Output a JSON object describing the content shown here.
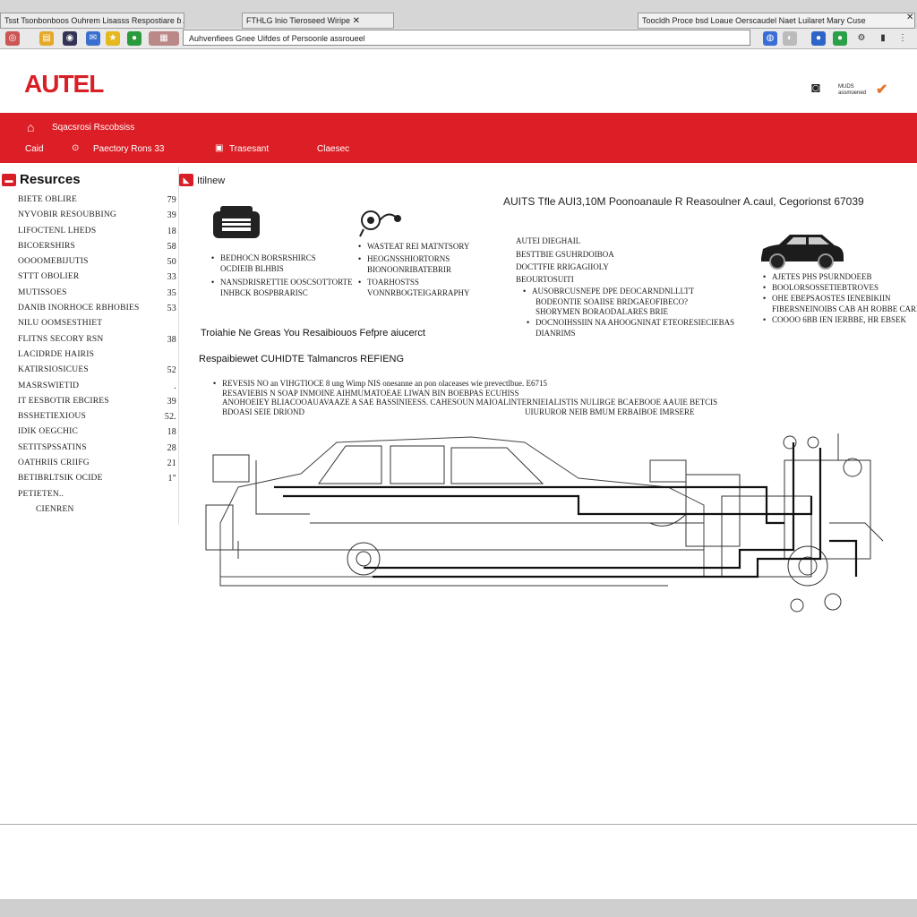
{
  "browser": {
    "tab1": "Tsst Tsonbonboos Ouhrem Lisasss  Respostiare ɓ  Aaudsaries",
    "tab2": "FTHLG lnio Tieroseed Wiripe",
    "tab3": "Toocldh Proce bsd Loaue  Oerscaudel Naet  Luilaret Mary Cuse",
    "address": "Auhvenfiees Gnee Uifdes of Persoonle assroueel"
  },
  "header": {
    "logo": "AUTEL",
    "right_caption": "MUDS\nassmoened"
  },
  "nav": {
    "top_label": "Sqacsrosi Rscobsiss",
    "item1": "Caid",
    "item2": "Paectory Rons 33",
    "item3": "Trasesant",
    "item4": "Claesec"
  },
  "sidebar": {
    "title": "Resurces",
    "items": [
      {
        "label": "BIETE  OBLIRE",
        "count": "79"
      },
      {
        "label": "NYVOBIR RESOUBBING",
        "count": "39"
      },
      {
        "label": "LIFOCTENL LHEDS",
        "count": "18"
      },
      {
        "label": "BICOERSHIRS",
        "count": "58"
      },
      {
        "label": "OOOOMEBIJUTIS",
        "count": "50"
      },
      {
        "label": "STTT OBOLIER",
        "count": "33"
      },
      {
        "label": "MUTISSOES",
        "count": "35"
      },
      {
        "label": "DANIB INORHOCE RBHOBIES",
        "count": "53"
      },
      {
        "label": "NILU OOMSESTHIET",
        "count": ""
      },
      {
        "label": "FLITNS SECORY RSN",
        "count": "38"
      },
      {
        "label": "LACIDRDE HAIRIS",
        "count": ""
      },
      {
        "label": "KATIRSIOSICUES",
        "count": "52"
      },
      {
        "label": "MASRSWIETID",
        "count": "."
      },
      {
        "label": "IT  EESBOTIR EBCIRES",
        "count": "39"
      },
      {
        "label": "BSSHETIEXIOUS",
        "count": "52."
      },
      {
        "label": "IDIK OEGCHIC",
        "count": "18"
      },
      {
        "label": "SETITSPSSATINS",
        "count": "28"
      },
      {
        "label": "OATHRIIS CRIIFG",
        "count": "21"
      },
      {
        "label": "BETIBRLTSIK OCIDE",
        "count": "1\""
      },
      {
        "label": "PETIETEN..",
        "count": ""
      },
      {
        "label": "CIENREN",
        "count": ""
      }
    ]
  },
  "main": {
    "title": "Itilnew",
    "product_title": "AUITS Tfle AUI3,10M  Poonoanaule R Reasoulner A.caul,  Cegorionst  67039",
    "feature1": [
      "BEDHOCN BORSRSHIRCS",
      "OCDIEIB BLHBIS",
      "NANSDRISRETTIE OOSCSOTTORTE",
      "INHBCK BOSPBRARISC"
    ],
    "feature2": [
      "WASTEAT REI MATNTSORY",
      "HEOGNSSHIORTORNS",
      "BIONOONRIBATEBRIR",
      "TOARHOSTSS",
      "VONNRBOGTEIGARRAPHY"
    ],
    "product_specs": [
      "AUTEI DIEGHAIL",
      "BESTTBIE GSUHRDOIBOA",
      "DOCTTFIE RRIGAGIIOLY",
      "BEOURTOSUITI",
      "AUSOBRCUSNEPE DPE DEOCARNDNLLLTT",
      "BODEONTIE SOAIISE BRDGAEOFIBECO?",
      "SHORYMEN BORAODALARES BRIE",
      "DOCNOIHSSIIN NA AHOOGNINAT ETEORESIECIEBAS",
      "DIANRIMS"
    ],
    "car_specs": [
      "AJETES PHS PSURNDOEEB",
      "BOOLORSOSSETIEBTROVES",
      "OHE EBEPSAOSTES IENEBIKIIN",
      "FIBERSNEINOIBS CAB AH ROBBE CAREI",
      "COOOO 6BB IEN IERBBE, HR EBSEK"
    ],
    "section1": "Troiahie Ne Greas You Resaibiouos Fefpre aiucerct",
    "section2": "Respaibiewet CUHIDTE Talmancros REFIENG",
    "desc": [
      "REVESIS NO an VIHGTIOCE 8 ung Wimp NIS onesanne an pon olaceases wie prevectlbue. E6715",
      "RESAVIEBIS N SOAP INMOINE AIHMUMATOEAE LIWAN BIN BOEBPAS ECUHISS",
      "ANOHOEIEY BLIACOOAUAVAAZE A SAE BASSINIEESS.  CAHESOUN MAIOALINTERNIEIALISTIS NULIRGE BCAEBOOE AAUIE BETCIS",
      "BDOASI SEIE DRIOND",
      "UIURUROR NEIB BMUM ERBAIBOE IMRSERE"
    ]
  }
}
